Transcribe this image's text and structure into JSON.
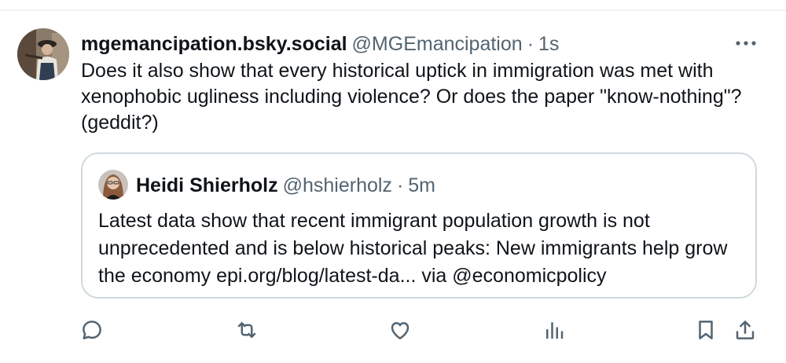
{
  "post": {
    "display_name": "mgemancipation.bsky.social",
    "handle": "@MGEmancipation",
    "separator": "·",
    "time": "1s",
    "text": "Does it also show that every historical uptick in immigration was met with xenophobic ugliness including violence? Or does the paper \"know-nothing\"? (geddit?)",
    "avatar_icon": "profile-photo-icon"
  },
  "quote": {
    "display_name": "Heidi Shierholz",
    "handle": "@hshierholz",
    "separator": "·",
    "time": "5m",
    "text": "Latest data show that recent immigrant population growth is not unprecedented and is below historical peaks: New immigrants help grow the economy epi.org/blog/latest-da... via @economicpolicy",
    "avatar_icon": "profile-photo-icon"
  },
  "actions": [
    {
      "icon": "reply-icon"
    },
    {
      "icon": "repost-icon"
    },
    {
      "icon": "like-icon"
    },
    {
      "icon": "views-icon"
    },
    {
      "icon": "bookmark-icon"
    },
    {
      "icon": "share-icon"
    }
  ],
  "colors": {
    "text": "#0f1419",
    "secondary": "#536471",
    "border": "#cfd9de"
  }
}
